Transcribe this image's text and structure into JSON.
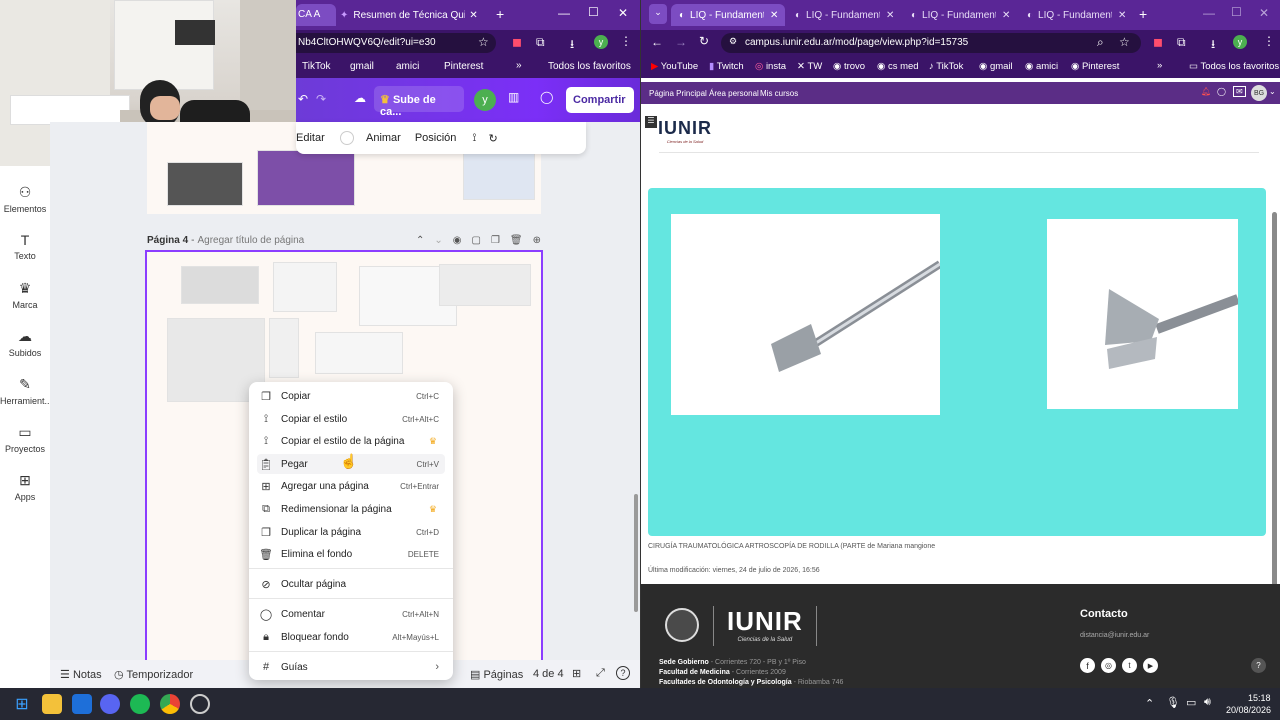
{
  "left_browser": {
    "tabs": [
      {
        "label": "CA A"
      },
      {
        "label": "Resumen de Técnica Quirúrgic"
      }
    ],
    "url": "Nb4CltOHWQV6Q/edit?ui=e30",
    "profile_initial": "y",
    "bookmarks": [
      "TikTok",
      "gmail",
      "amici",
      "Pinterest"
    ],
    "all_favorites": "Todos los favoritos"
  },
  "canva": {
    "save_label": "Sube de ca...",
    "user_initial": "y",
    "share_label": "Compartir",
    "toolbar": {
      "edit": "Editar",
      "animate": "Animar",
      "position": "Posición"
    },
    "sidebar": [
      {
        "label": "Elementos",
        "icon": "elements-icon"
      },
      {
        "label": "Texto",
        "icon": "text-icon"
      },
      {
        "label": "Marca",
        "icon": "brand-icon"
      },
      {
        "label": "Subidos",
        "icon": "upload-icon"
      },
      {
        "label": "Herramient...",
        "icon": "tools-icon"
      },
      {
        "label": "Proyectos",
        "icon": "folder-icon"
      },
      {
        "label": "Apps",
        "icon": "apps-icon"
      }
    ],
    "page_label": "Página 4",
    "page_title_placeholder": "Agregar título de página",
    "bottom": {
      "notes": "Notas",
      "timer": "Temporizador",
      "pages": "Páginas",
      "page_count": "4 de 4"
    }
  },
  "context_menu": {
    "items": [
      {
        "label": "Copiar",
        "shortcut": "Ctrl+C",
        "icon": "copy-icon"
      },
      {
        "label": "Copiar el estilo",
        "shortcut": "Ctrl+Alt+C",
        "icon": "paint-roller-icon"
      },
      {
        "label": "Copiar el estilo de la página",
        "shortcut": "",
        "icon": "paint-roller-icon",
        "premium": true
      },
      {
        "label": "Pegar",
        "shortcut": "Ctrl+V",
        "icon": "paste-icon"
      },
      {
        "label": "Agregar una página",
        "shortcut": "Ctrl+Entrar",
        "icon": "add-page-icon"
      },
      {
        "label": "Redimensionar la página",
        "shortcut": "",
        "icon": "resize-icon",
        "premium": true
      },
      {
        "label": "Duplicar la página",
        "shortcut": "Ctrl+D",
        "icon": "duplicate-icon"
      },
      {
        "label": "Elimina el fondo",
        "shortcut": "DELETE",
        "icon": "trash-icon"
      },
      {
        "label": "Ocultar página",
        "shortcut": "",
        "icon": "hide-icon"
      },
      {
        "label": "Comentar",
        "shortcut": "Ctrl+Alt+N",
        "icon": "comment-icon"
      },
      {
        "label": "Bloquear fondo",
        "shortcut": "Alt+Mayús+L",
        "icon": "lock-icon"
      },
      {
        "label": "Guías",
        "shortcut": "",
        "icon": "grid-icon",
        "submenu": true
      }
    ]
  },
  "right_browser": {
    "tabs": [
      {
        "label": "LIQ - Fundamentos"
      },
      {
        "label": "LIQ - Fundamento"
      },
      {
        "label": "LIQ - Fundamento"
      },
      {
        "label": "LIQ - Fundamento"
      }
    ],
    "url": "campus.iunir.edu.ar/mod/page/view.php?id=15735",
    "profile_initial": "y",
    "bookmarks": [
      "YouTube",
      "Twitch",
      "insta",
      "TW",
      "trovo",
      "cs med",
      "TikTok",
      "gmail",
      "amici",
      "Pinterest"
    ],
    "all_favorites": "Todos los favoritos"
  },
  "moodle": {
    "nav": [
      "Página Principal",
      "Área personal",
      "Mis cursos"
    ],
    "user_initials": "BG",
    "logo": "IUNIR",
    "logo_sub": "Ciencias de la Salud",
    "caption_main": "CIRUGÍA TRAUMATOLÓGICA ARTROSCOPÍA DE RODILLA (PARTE",
    "caption_author": "de Mariana mangione",
    "last_modified": "Última modificación: viernes, 24 de julio de 2026, 16:56",
    "slide_bg": "#64e6e0",
    "footer": {
      "logo": "IUNIR",
      "logo_sub": "Ciencias de la Salud",
      "contact_title": "Contacto",
      "contact_email": "distancia@iunir.edu.ar",
      "addresses": [
        {
          "label": "Sede Gobierno",
          "value": "- Corrientes 720 - PB y 1º Piso"
        },
        {
          "label": "Facultad de Medicina",
          "value": "- Corrientes 2009"
        },
        {
          "label": "Facultades de Odontología y Psicología",
          "value": "- Riobamba 746"
        }
      ]
    }
  },
  "taskbar": {
    "time": "15:18",
    "date": "20/08/2026"
  }
}
